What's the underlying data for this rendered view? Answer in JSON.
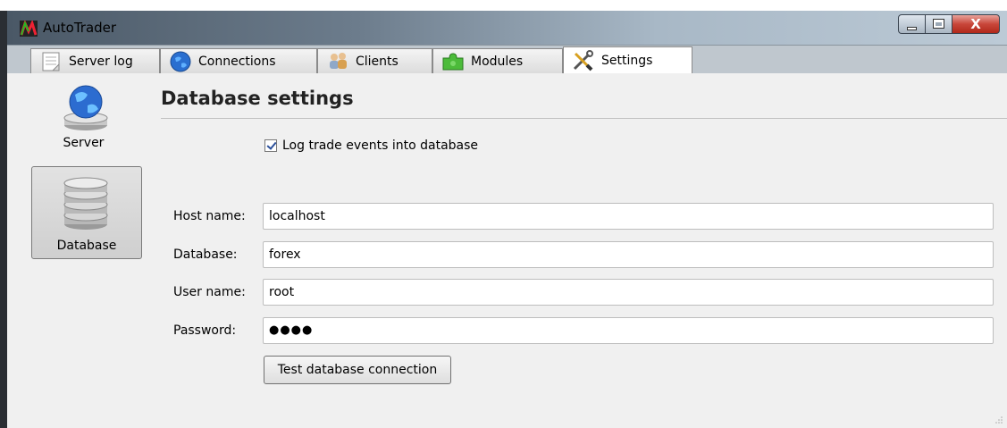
{
  "window": {
    "title": "AutoTrader",
    "close_symbol": "X"
  },
  "tabs": [
    {
      "label": "Server log",
      "icon": "document-icon"
    },
    {
      "label": "Connections",
      "icon": "globe-icon"
    },
    {
      "label": "Clients",
      "icon": "users-icon"
    },
    {
      "label": "Modules",
      "icon": "puzzle-icon"
    },
    {
      "label": "Settings",
      "icon": "tools-icon"
    }
  ],
  "active_tab": "Settings",
  "sidebar": {
    "items": [
      {
        "label": "Server",
        "icon": "globe-server-icon",
        "selected": false
      },
      {
        "label": "Database",
        "icon": "database-icon",
        "selected": true
      }
    ]
  },
  "settings": {
    "heading": "Database settings",
    "log_checkbox_label": "Log trade events into database",
    "log_checked": true,
    "fields": [
      {
        "label": "Host name:",
        "value": "localhost"
      },
      {
        "label": "Database:",
        "value": "forex"
      },
      {
        "label": "User name:",
        "value": "root"
      },
      {
        "label": "Password:",
        "value": "●●●●"
      }
    ],
    "test_button_label": "Test database connection"
  },
  "colors": {
    "title_bar": "#6c7c8c",
    "tab_bar": "#bfc7ce",
    "content_bg": "#f0f0f0",
    "close_button": "#c8463a"
  }
}
